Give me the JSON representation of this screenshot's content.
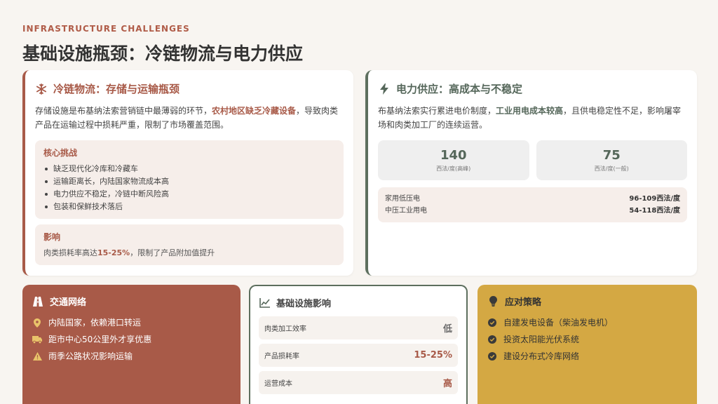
{
  "header": {
    "eyebrow": "INFRASTRUCTURE CHALLENGES",
    "title": "基础设施瓶颈：冷链物流与电力供应"
  },
  "cold_chain": {
    "icon": "snowflake-icon",
    "title": "冷链物流：存储与运输瓶颈",
    "para_before": "存储设施是布基纳法索营销链中最薄弱的环节，",
    "para_highlight": "农村地区缺乏冷藏设备",
    "para_after": "，导致肉类产品在运输过程中损耗严重，限制了市场覆盖范围。",
    "core_title": "核心挑战",
    "core_items": [
      "缺乏现代化冷库和冷藏车",
      "运输距离长，内陆国家物流成本高",
      "电力供应不稳定，冷链中断风险高",
      "包装和保鲜技术落后"
    ],
    "impact_title": "影响",
    "impact_before": "肉类损耗率高达",
    "impact_value": "15-25%",
    "impact_after": "，限制了产品附加值提升"
  },
  "power": {
    "icon": "lightning-icon",
    "title": "电力供应：高成本与不稳定",
    "para_before": "布基纳法索实行累进电价制度，",
    "para_highlight": "工业用电成本较高",
    "para_after": "，且供电稳定性不足，影响屠宰场和肉类加工厂的连续运营。",
    "stats": [
      {
        "value": "140",
        "unit": "西法/度(高峰)"
      },
      {
        "value": "75",
        "unit": "西法/度(一般)"
      }
    ],
    "prices": [
      {
        "label": "家用低压电",
        "value": "96-109西法/度"
      },
      {
        "label": "中压工业用电",
        "value": "54-118西法/度"
      }
    ]
  },
  "transport": {
    "icon": "road-icon",
    "title": "交通网络",
    "items": [
      {
        "icon": "location-pin-icon",
        "text": "内陆国家，依赖港口转运"
      },
      {
        "icon": "truck-icon",
        "text": "距市中心50公里外才享优惠"
      },
      {
        "icon": "warning-icon",
        "text": "雨季公路状况影响运输"
      }
    ]
  },
  "infra_impact": {
    "icon": "line-chart-icon",
    "title": "基础设施影响",
    "rows": [
      {
        "label": "肉类加工效率",
        "value": "低"
      },
      {
        "label": "产品损耗率",
        "value": "15-25%"
      },
      {
        "label": "运营成本",
        "value": "高"
      }
    ]
  },
  "strategy": {
    "icon": "lightbulb-icon",
    "title": "应对策略",
    "items": [
      "自建发电设备（柴油发电机）",
      "投资太阳能光伏系统",
      "建设分布式冷库网络"
    ]
  },
  "colors": {
    "accent_red": "#a85a48",
    "accent_green": "#5d6f5e",
    "accent_gold": "#d4a843",
    "background": "#f8f5f1"
  }
}
